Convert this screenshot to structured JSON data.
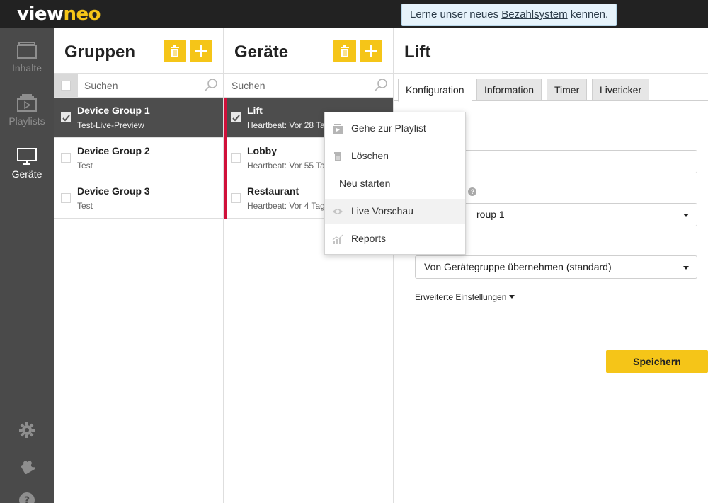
{
  "app": {
    "logo_part1": "view",
    "logo_part2": "neo",
    "notice_prefix": "Lerne unser neues ",
    "notice_link": "Bezahlsystem",
    "notice_suffix": " kennen."
  },
  "nav": {
    "items": [
      {
        "label": "Inhalte",
        "icon": "folder-icon"
      },
      {
        "label": "Playlists",
        "icon": "playlist-icon"
      },
      {
        "label": "Geräte",
        "icon": "monitor-icon"
      }
    ],
    "bottom_icons": [
      "gear-icon",
      "puzzle-icon",
      "help-icon"
    ]
  },
  "groups": {
    "title": "Gruppen",
    "search_placeholder": "Suchen",
    "items": [
      {
        "name": "Device Group 1",
        "sub": "Test-Live-Preview",
        "selected": true
      },
      {
        "name": "Device Group 2",
        "sub": "Test",
        "selected": false
      },
      {
        "name": "Device Group 3",
        "sub": "Test",
        "selected": false
      }
    ]
  },
  "devices": {
    "title": "Geräte",
    "search_placeholder": "Suchen",
    "items": [
      {
        "name": "Lift",
        "sub": "Heartbeat: Vor 28 Ta",
        "selected": true
      },
      {
        "name": "Lobby",
        "sub": "Heartbeat: Vor 55 Ta",
        "selected": false
      },
      {
        "name": "Restaurant",
        "sub": "Heartbeat: Vor 4 Tage",
        "selected": false
      }
    ]
  },
  "detail": {
    "title": "Lift",
    "tabs": [
      "Konfiguration",
      "Information",
      "Timer",
      "Liveticker"
    ],
    "active_tab": "Konfiguration",
    "label_group_fragment": "e:",
    "group_select_value": "roup 1",
    "mode_select_value": "Von Gerätegruppe übernehmen (standard)",
    "advanced_label": "Erweiterte Einstellungen",
    "save_label": "Speichern"
  },
  "context_menu": {
    "items": [
      {
        "label": "Gehe zur Playlist",
        "icon": "playlist-icon"
      },
      {
        "label": "Löschen",
        "icon": "trash-icon"
      },
      {
        "label": "Neu starten",
        "icon": ""
      },
      {
        "label": "Live Vorschau",
        "icon": "eye-icon"
      },
      {
        "label": "Reports",
        "icon": "chart-icon"
      }
    ],
    "hovered": "Live Vorschau"
  },
  "colors": {
    "accent": "#f5c518",
    "topbar": "#222222",
    "sidebar": "#4a4a4a",
    "selected_row": "#4d4d4d",
    "status_offline": "#d0103a"
  }
}
